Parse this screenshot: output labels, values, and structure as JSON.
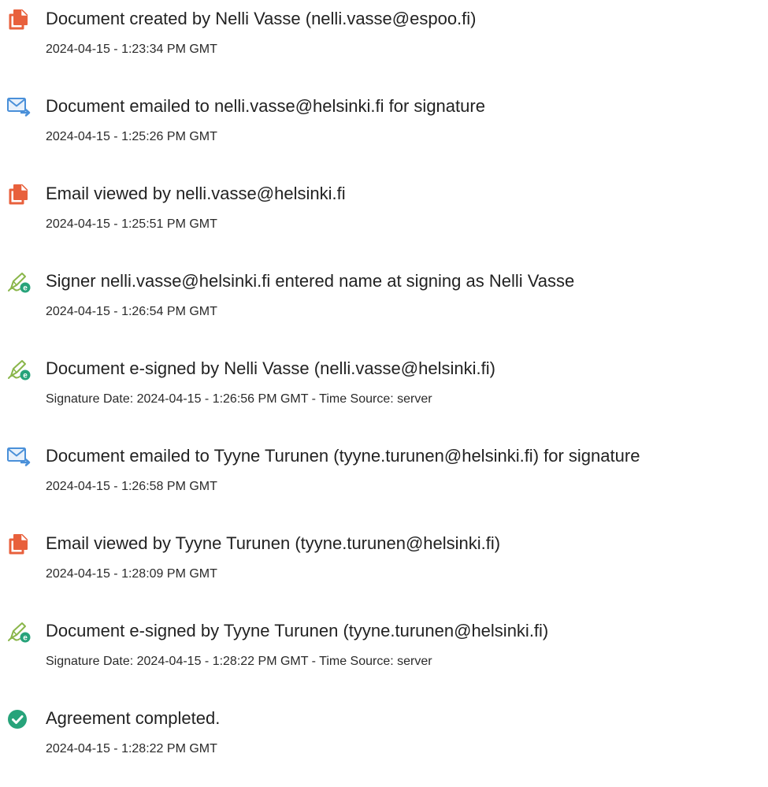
{
  "events": [
    {
      "icon": "document-icon",
      "title": "Document created by Nelli Vasse (nelli.vasse@espoo.fi)",
      "detail": "2024-04-15 - 1:23:34 PM GMT"
    },
    {
      "icon": "email-send-icon",
      "title": "Document emailed to nelli.vasse@helsinki.fi for signature",
      "detail": "2024-04-15 - 1:25:26 PM GMT"
    },
    {
      "icon": "document-icon",
      "title": "Email viewed by nelli.vasse@helsinki.fi",
      "detail": "2024-04-15 - 1:25:51 PM GMT"
    },
    {
      "icon": "e-sign-pen-icon",
      "title": "Signer nelli.vasse@helsinki.fi entered name at signing as Nelli Vasse",
      "detail": "2024-04-15 - 1:26:54 PM GMT"
    },
    {
      "icon": "e-sign-pen-icon",
      "title": "Document e-signed by Nelli Vasse (nelli.vasse@helsinki.fi)",
      "detail": "Signature Date: 2024-04-15 - 1:26:56 PM GMT - Time Source: server"
    },
    {
      "icon": "email-send-icon",
      "title": "Document emailed to Tyyne Turunen (tyyne.turunen@helsinki.fi) for signature",
      "detail": "2024-04-15 - 1:26:58 PM GMT"
    },
    {
      "icon": "document-icon",
      "title": "Email viewed by Tyyne Turunen (tyyne.turunen@helsinki.fi)",
      "detail": "2024-04-15 - 1:28:09 PM GMT"
    },
    {
      "icon": "e-sign-pen-icon",
      "title": "Document e-signed by Tyyne Turunen (tyyne.turunen@helsinki.fi)",
      "detail": "Signature Date: 2024-04-15 - 1:28:22 PM GMT - Time Source: server"
    },
    {
      "icon": "check-circle-icon",
      "title": "Agreement completed.",
      "detail": "2024-04-15 - 1:28:22 PM GMT"
    }
  ],
  "colors": {
    "document_icon": "#e8603c",
    "email_icon": "#4a90d9",
    "pen_icon": "#8ab64a",
    "pen_badge": "#27a37a",
    "check_icon": "#27a37a"
  }
}
